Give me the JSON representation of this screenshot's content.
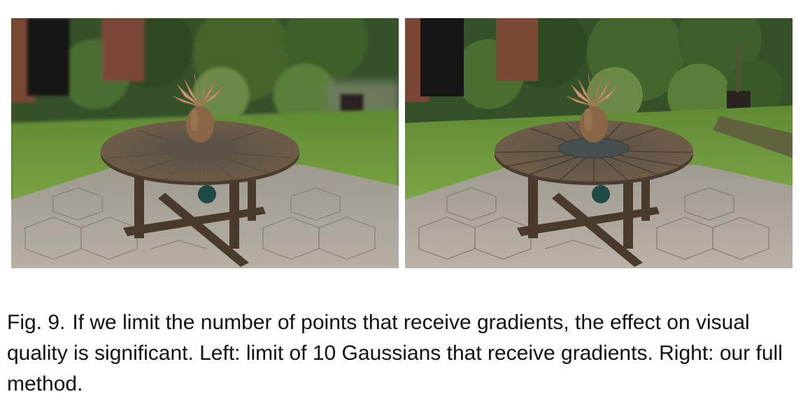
{
  "figure": {
    "label": "Fig. 9.",
    "caption": "If we limit the number of points that receive gradients, the effect on visual quality is significant. Left: limit of 10 Gaussians that receive gradients. Right: our full method."
  },
  "colors": {
    "foliage_dark": "#2f4a22",
    "foliage_mid": "#4f6e32",
    "grass": "#6f9a3c",
    "brick": "#7a4636",
    "door": "#161616",
    "paving": "#a9a49a",
    "table_wood": "#6b5a48",
    "table_center_left": "#5b5347",
    "table_center_right": "#46504e",
    "vase": "#8a6647",
    "palm_leaf": "#c99b73",
    "ball": "#1f4a44"
  }
}
